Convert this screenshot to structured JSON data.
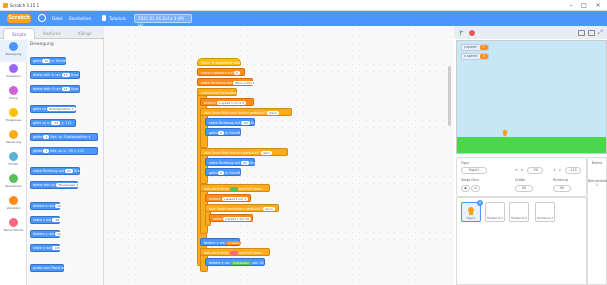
{
  "window": {
    "title": "Scratch 3.15.1"
  },
  "menu": {
    "logo": "Scratch",
    "items": [
      "Datei",
      "Bearbeiten",
      "Tutorials"
    ],
    "project_title": "2021 01 04 Zuf a 3 (Mi Hir..."
  },
  "tabs": [
    "Skripte",
    "Kostüme",
    "Klänge"
  ],
  "categories": [
    {
      "label": "Bewegung",
      "color": "#4c97ff"
    },
    {
      "label": "Aussehen",
      "color": "#9966ff"
    },
    {
      "label": "Klang",
      "color": "#cf63cf"
    },
    {
      "label": "Ereignisse",
      "color": "#ffbf00"
    },
    {
      "label": "Steuerung",
      "color": "#ffab19"
    },
    {
      "label": "Fühlen",
      "color": "#5cb1d6"
    },
    {
      "label": "Operatoren",
      "color": "#59c059"
    },
    {
      "label": "Variablen",
      "color": "#ff8c1a"
    },
    {
      "label": "Meine Blöcke",
      "color": "#ff6680"
    }
  ],
  "palette": {
    "heading": "Bewegung",
    "blocks": [
      {
        "text": "gehe",
        "slot": "10",
        "suffix": "er Schritt"
      },
      {
        "text": "drehe dich ↻ um",
        "slot": "15",
        "suffix": "Grad"
      },
      {
        "text": "drehe dich ↺ um",
        "slot": "15",
        "suffix": "Grad"
      },
      {
        "text": "gehe zu",
        "slot": "Zufallsposition ▾",
        "suffix": ""
      },
      {
        "text": "gehe zu x:",
        "slot": "-39",
        "suffix": "y: 115"
      },
      {
        "text": "gleite",
        "slot": "1",
        "suffix": "Sek. zu Zufallsposition ▾"
      },
      {
        "text": "gleite",
        "slot": "1",
        "suffix": "Sek. zu x: -39 y: 115"
      },
      {
        "text": "setze Richtung auf",
        "slot": "90",
        "suffix": "Grad"
      },
      {
        "text": "drehe dich zu",
        "slot": "Mauszeiger ▾",
        "suffix": ""
      },
      {
        "text": "ändere x um",
        "slot": "10",
        "suffix": ""
      },
      {
        "text": "setze x auf",
        "slot": "-39",
        "suffix": ""
      },
      {
        "text": "ändere y um",
        "slot": "10",
        "suffix": ""
      },
      {
        "text": "setze y auf",
        "slot": "115",
        "suffix": ""
      },
      {
        "text": "pralle vom Rand ab",
        "slot": "",
        "suffix": ""
      }
    ]
  },
  "code": {
    "blocks": [
      {
        "cls": "c-event",
        "text": "Wenn ⚑ angeklickt wird"
      },
      {
        "cls": "c-var",
        "text": "setze x.speed ▾ auf",
        "slot": "0"
      },
      {
        "cls": "c-var",
        "text": "setze Richtung auf",
        "slot": "Maus-x-Pos ▾"
      },
      {
        "cls": "c-control",
        "text": "wiederhole fortlaufend"
      },
      {
        "cls": "c-control",
        "text": "ändere",
        "slot": "x.speed ▾ um 0.5"
      },
      {
        "cls": "c-sensing",
        "text": "falls Taste Pfeil nach links ▾ gedrückt?",
        "slot": "dann"
      },
      {
        "cls": "c-motion",
        "text": "setze Richtung auf",
        "slot": "-90",
        "suffix": "Grad"
      },
      {
        "cls": "c-motion",
        "text": "gehe",
        "slot": "5",
        "suffix": "er Schritt"
      },
      {
        "cls": "c-sensing",
        "text": "falls Taste Pfeil rechts ▾ gedrückt?",
        "slot": "dann"
      },
      {
        "cls": "c-motion",
        "text": "setze Richtung auf",
        "slot": "90",
        "suffix": "Grad"
      },
      {
        "cls": "c-motion",
        "text": "gehe",
        "slot": "5",
        "suffix": "er Schritt"
      },
      {
        "cls": "c-control",
        "text": "falls wird Farbe",
        "slot": "",
        "suffix": "berührt? dann"
      },
      {
        "cls": "c-var",
        "text": "ändere",
        "slot": "y.speed ▾ um 1"
      },
      {
        "cls": "c-sensing",
        "text": "falls Taste Leertaste ▾ gedrückt?",
        "slot": "dann"
      },
      {
        "cls": "c-var",
        "text": "setze",
        "slot": "y.speed ▾ auf 10"
      },
      {
        "cls": "c-var",
        "text": "ändere y um",
        "slot": "y.speed"
      },
      {
        "cls": "c-control",
        "text": "falls wird Farbe",
        "slot": "",
        "suffix": "berührt? dann"
      },
      {
        "cls": "c-motion",
        "text": "ändere y um",
        "slot": "Zufallszahl",
        "suffix": "von 10"
      }
    ]
  },
  "stage": {
    "monitors": [
      {
        "label": "y.speed",
        "value": "0"
      },
      {
        "label": "x.speed",
        "value": "0"
      }
    ],
    "sky_color": "#c6e8f6",
    "grass_color": "#4bd64b"
  },
  "sprite_info": {
    "sprite_label": "Figur",
    "sprite_name": "Figur1",
    "x_label": "x",
    "x_value": "-39",
    "y_label": "y",
    "y_value": "-115",
    "show_label": "Zeige Dich",
    "size_label": "Größe",
    "size_value": "50",
    "dir_label": "Richtung",
    "dir_value": "90"
  },
  "sprites": [
    "Figur1",
    "Hindernis 1",
    "Hindernis 2",
    "Hindernis 3"
  ],
  "stage_panel": {
    "label": "Bühne",
    "backdrops_label": "Bühnenbilder",
    "backdrops_count": "1"
  }
}
